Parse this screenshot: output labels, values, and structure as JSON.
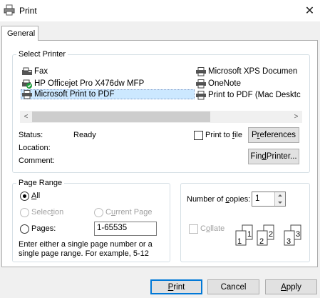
{
  "window": {
    "title": "Print",
    "close_symbol": "✕"
  },
  "tabs": [
    {
      "label": "General"
    }
  ],
  "select_printer": {
    "legend": "Select Printer",
    "printers": [
      {
        "name": "Fax",
        "icon": "fax-icon"
      },
      {
        "name": "HP Officejet Pro X476dw MFP",
        "icon": "default-printer-icon"
      },
      {
        "name": "Microsoft Print to PDF",
        "icon": "printer-icon",
        "selected": true
      },
      {
        "name": "Microsoft XPS Documen",
        "icon": "printer-icon"
      },
      {
        "name": "OneNote",
        "icon": "printer-icon"
      },
      {
        "name": "Print to PDF (Mac Desktc",
        "icon": "printer-icon"
      }
    ],
    "scroll_left": "<",
    "scroll_right": ">",
    "status_label": "Status:",
    "status_value": "Ready",
    "location_label": "Location:",
    "comment_label": "Comment:",
    "print_to_file_pre": "Print to ",
    "print_to_file_u": "f",
    "print_to_file_post": "ile",
    "preferences_pre": "P",
    "preferences_u": "r",
    "preferences_post": "eferences",
    "find_printer_pre": "Fin",
    "find_printer_u": "d",
    "find_printer_post": " Printer..."
  },
  "page_range": {
    "legend": "Page Range",
    "all_u": "A",
    "all_post": "ll",
    "selection_pre": "Selec",
    "selection_u": "t",
    "selection_post": "ion",
    "current_pre": "C",
    "current_u": "u",
    "current_post": "rrent Page",
    "pages_pre": "Pa",
    "pages_u": "g",
    "pages_post": "es:",
    "pages_value": "1-65535",
    "hint": "Enter either a single page number or a single page range.  For example, 5-12"
  },
  "copies": {
    "label_pre": "Number of ",
    "label_u": "c",
    "label_post": "opies:",
    "value": "1",
    "collate_pre": "C",
    "collate_u": "o",
    "collate_post": "llate",
    "collate_pages": [
      "1",
      "1",
      "2",
      "2",
      "3",
      "3"
    ]
  },
  "buttons": {
    "print_u": "P",
    "print_post": "rint",
    "cancel": "Cancel",
    "apply_u": "A",
    "apply_post": "pply"
  }
}
